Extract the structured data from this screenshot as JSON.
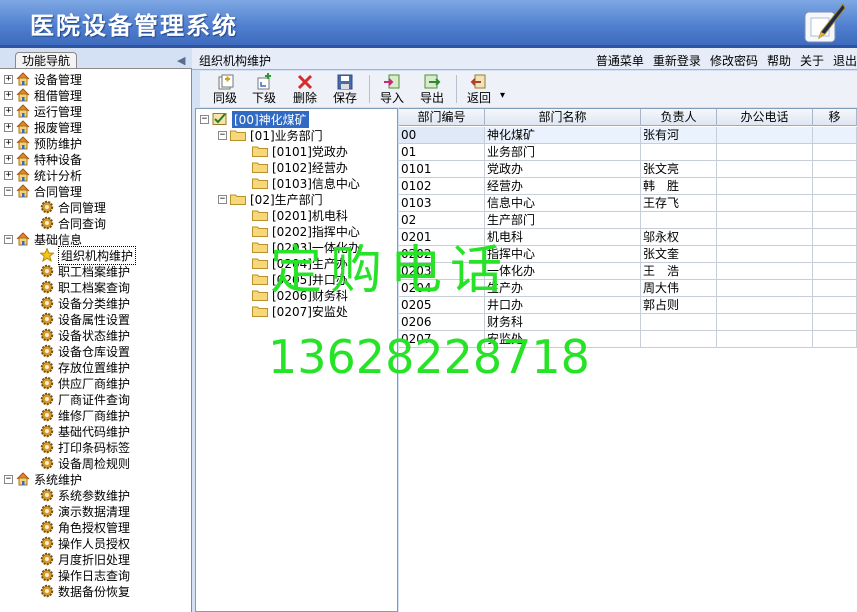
{
  "app": {
    "title": "医院设备管理系统"
  },
  "nav": {
    "tab": "功能导航",
    "items": [
      {
        "label": "设备管理",
        "type": "group",
        "expanded": false
      },
      {
        "label": "租借管理",
        "type": "group",
        "expanded": false
      },
      {
        "label": "运行管理",
        "type": "group",
        "expanded": false
      },
      {
        "label": "报废管理",
        "type": "group",
        "expanded": false
      },
      {
        "label": "预防维护",
        "type": "group",
        "expanded": false
      },
      {
        "label": "特种设备",
        "type": "group",
        "expanded": false
      },
      {
        "label": "统计分析",
        "type": "group",
        "expanded": false
      },
      {
        "label": "合同管理",
        "type": "group",
        "expanded": true
      },
      {
        "label": "合同管理",
        "type": "leaf"
      },
      {
        "label": "合同查询",
        "type": "leaf"
      },
      {
        "label": "基础信息",
        "type": "group",
        "expanded": true
      },
      {
        "label": "组织机构维护",
        "type": "leaf",
        "selected": true
      },
      {
        "label": "职工档案维护",
        "type": "leaf"
      },
      {
        "label": "职工档案查询",
        "type": "leaf"
      },
      {
        "label": "设备分类维护",
        "type": "leaf"
      },
      {
        "label": "设备属性设置",
        "type": "leaf"
      },
      {
        "label": "设备状态维护",
        "type": "leaf"
      },
      {
        "label": "设备仓库设置",
        "type": "leaf"
      },
      {
        "label": "存放位置维护",
        "type": "leaf"
      },
      {
        "label": "供应厂商维护",
        "type": "leaf"
      },
      {
        "label": "厂商证件查询",
        "type": "leaf"
      },
      {
        "label": "维修厂商维护",
        "type": "leaf"
      },
      {
        "label": "基础代码维护",
        "type": "leaf"
      },
      {
        "label": "打印条码标签",
        "type": "leaf"
      },
      {
        "label": "设备周检规则",
        "type": "leaf"
      },
      {
        "label": "系统维护",
        "type": "group",
        "expanded": true
      },
      {
        "label": "系统参数维护",
        "type": "leaf"
      },
      {
        "label": "演示数据清理",
        "type": "leaf"
      },
      {
        "label": "角色授权管理",
        "type": "leaf"
      },
      {
        "label": "操作人员授权",
        "type": "leaf"
      },
      {
        "label": "月度折旧处理",
        "type": "leaf"
      },
      {
        "label": "操作日志查询",
        "type": "leaf"
      },
      {
        "label": "数据备份恢复",
        "type": "leaf"
      }
    ]
  },
  "header": {
    "breadcrumb": "组织机构维护",
    "menu": [
      "普通菜单",
      "重新登录",
      "修改密码",
      "帮助",
      "关于",
      "退出"
    ]
  },
  "toolbar": {
    "buttons": [
      "同级",
      "下级",
      "删除",
      "保存",
      "导入",
      "导出",
      "返回"
    ],
    "back_dropdown": "▾"
  },
  "tree": {
    "nodes": [
      {
        "label": "[00]神化煤矿",
        "level": 0,
        "root": true
      },
      {
        "label": "[01]业务部门",
        "level": 1,
        "expanded": true
      },
      {
        "label": "[0101]党政办",
        "level": 2
      },
      {
        "label": "[0102]经营办",
        "level": 2
      },
      {
        "label": "[0103]信息中心",
        "level": 2
      },
      {
        "label": "[02]生产部门",
        "level": 1,
        "expanded": true
      },
      {
        "label": "[0201]机电科",
        "level": 2
      },
      {
        "label": "[0202]指挥中心",
        "level": 2
      },
      {
        "label": "[0203]一体化办",
        "level": 2
      },
      {
        "label": "[0204]生产办",
        "level": 2
      },
      {
        "label": "[0205]井口办",
        "level": 2
      },
      {
        "label": "[0206]财务科",
        "level": 2
      },
      {
        "label": "[0207]安监处",
        "level": 2
      }
    ]
  },
  "grid": {
    "columns": [
      "部门编号",
      "部门名称",
      "负责人",
      "办公电话",
      "移"
    ],
    "rows": [
      [
        "00",
        "神化煤矿",
        "张有河",
        "",
        ""
      ],
      [
        "01",
        "业务部门",
        "",
        "",
        ""
      ],
      [
        "0101",
        "党政办",
        "张文亮",
        "",
        ""
      ],
      [
        "0102",
        "经营办",
        "韩　胜",
        "",
        ""
      ],
      [
        "0103",
        "信息中心",
        "王存飞",
        "",
        ""
      ],
      [
        "02",
        "生产部门",
        "",
        "",
        ""
      ],
      [
        "0201",
        "机电科",
        "邬永权",
        "",
        ""
      ],
      [
        "0202",
        "指挥中心",
        "张文奎",
        "",
        ""
      ],
      [
        "0203",
        "一体化办",
        "王　浩",
        "",
        ""
      ],
      [
        "0204",
        "生产办",
        "周大伟",
        "",
        ""
      ],
      [
        "0205",
        "井口办",
        "郭占则",
        "",
        ""
      ],
      [
        "0206",
        "财务科",
        "",
        "",
        ""
      ],
      [
        "0207",
        "安监处",
        "",
        "",
        ""
      ]
    ]
  },
  "overlay": {
    "line1": "定购电话",
    "line2": "13628228718"
  }
}
